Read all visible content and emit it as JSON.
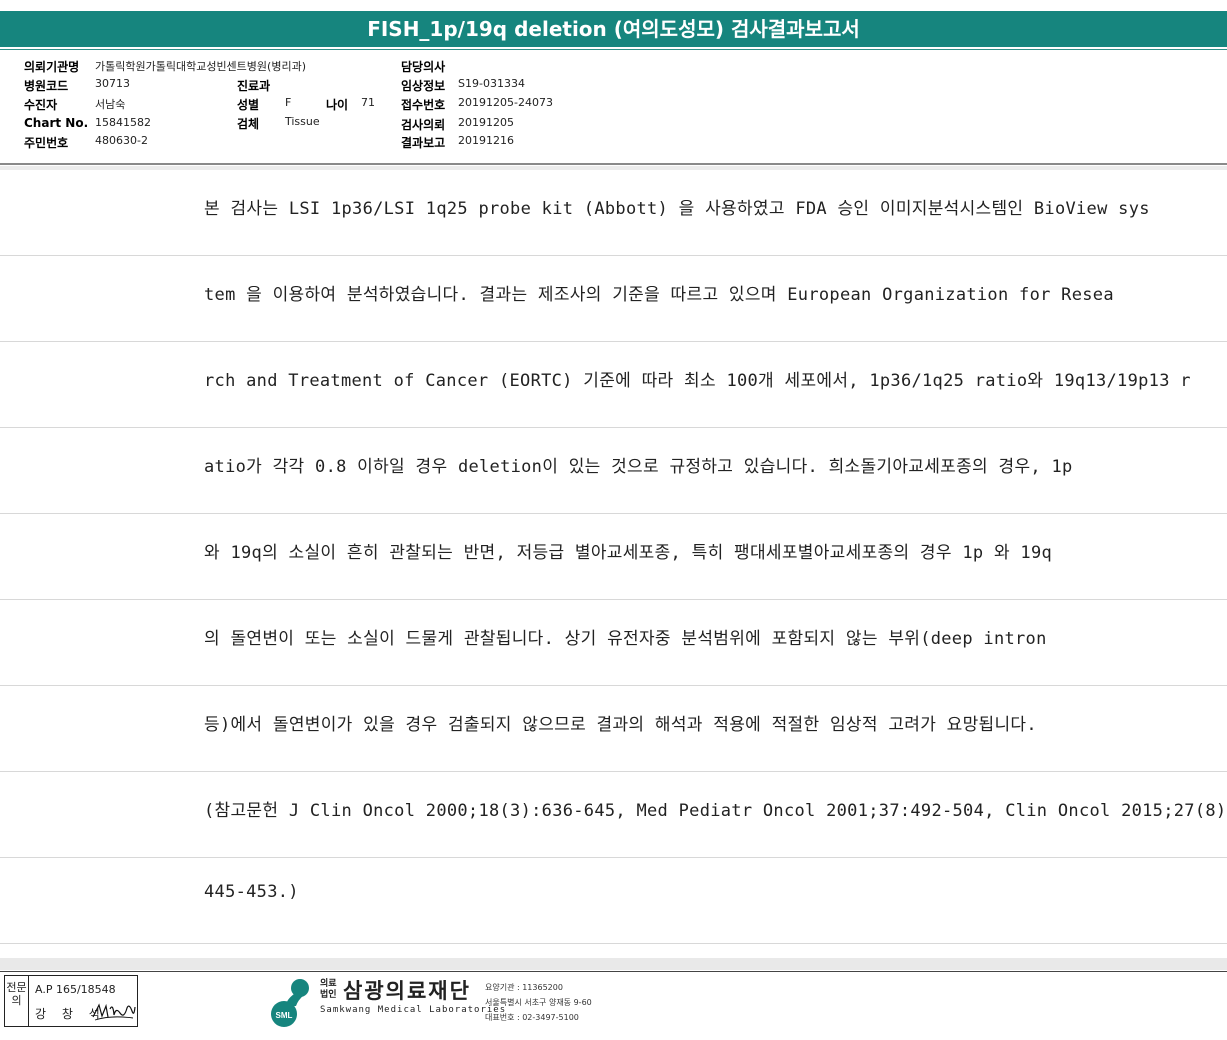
{
  "report": {
    "title": "FISH_1p/19q deletion (여의도성모) 검사결과보고서"
  },
  "info": {
    "institution_label": "의뢰기관명",
    "institution_value": "가톨릭학원가톨릭대학교성빈센트병원(병리과)",
    "hospital_code_label": "병원코드",
    "hospital_code_value": "30713",
    "patient_label": "수진자",
    "patient_value": "서남숙",
    "chart_label": "Chart No.",
    "chart_value": "15841582",
    "resident_label": "주민번호",
    "resident_value": "480630-2",
    "department_label": "진료과",
    "department_value": "",
    "sex_label": "성별",
    "sex_value": "F",
    "age_label": "나이",
    "age_value": "71",
    "specimen_label": "검체",
    "specimen_value": "Tissue",
    "doctor_label": "담당의사",
    "doctor_value": "",
    "clinical_label": "임상정보",
    "clinical_value": "S19-031334",
    "receipt_label": "접수번호",
    "receipt_value": "20191205-24073",
    "request_label": "검사의뢰",
    "request_value": "20191205",
    "result_label": "결과보고",
    "result_value": "20191216"
  },
  "body_lines": [
    "본 검사는 LSI 1p36/LSI 1q25 probe kit (Abbott) 을 사용하였고 FDA 승인 이미지분석시스템인 BioView sys",
    "tem 을 이용하여 분석하였습니다. 결과는 제조사의 기준을 따르고 있으며 European Organization for Resea",
    "rch and Treatment of Cancer (EORTC) 기준에 따라 최소 100개 세포에서, 1p36/1q25 ratio와 19q13/19p13 r",
    "atio가 각각 0.8 이하일 경우 deletion이 있는 것으로 규정하고 있습니다. 희소돌기아교세포종의 경우, 1p",
    "와 19q의 소실이 흔히 관찰되는 반면, 저등급 별아교세포종, 특히 팽대세포별아교세포종의 경우 1p 와 19q",
    "의 돌연변이 또는 소실이 드물게 관찰됩니다. 상기 유전자중 분석범위에 포함되지 않는 부위(deep intron",
    "등)에서 돌연변이가 있을 경우 검출되지 않으므로 결과의 해석과 적용에 적절한 임상적 고려가 요망됩니다.",
    "(참고문헌 J Clin Oncol 2000;18(3):636-645, Med Pediatr Oncol 2001;37:492-504, Clin Oncol 2015;27(8):",
    "445-453.)"
  ],
  "signature": {
    "label": "전문의",
    "ap_number": "A.P 165/18548",
    "name": "강 창 석"
  },
  "footer": {
    "org_type": "의료\n법인",
    "org_name": "삼광의료재단",
    "org_english": "Samkwang Medical Laboratories",
    "logo_text": "SML",
    "code_line": "요양기관 : 11365200",
    "address_line": "서울특별시 서초구 양재동 9-60",
    "phone_line": "대표번호 : 02-3497-5100",
    "brand_color": "#16857e"
  }
}
